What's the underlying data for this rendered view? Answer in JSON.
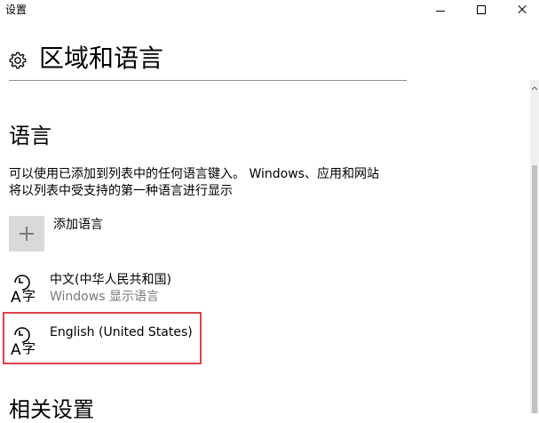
{
  "window": {
    "title": "设置"
  },
  "header": {
    "title": "区域和语言",
    "icon": "gear-icon"
  },
  "language_section": {
    "title": "语言",
    "description_lines": [
      "可以使用已添加到列表中的任何语言键入。 Windows、应用和网站",
      "将以列表中受支持的第一种语言进行显示"
    ],
    "add_language_label": "添加语言",
    "items": [
      {
        "name": "中文(中华人民共和国)",
        "subtitle": "Windows 显示语言"
      },
      {
        "name": "English (United States)",
        "subtitle": ""
      }
    ]
  },
  "related_section": {
    "title": "相关设置"
  },
  "colors": {
    "highlight_border": "#d9434c",
    "divider": "#8f8f8f",
    "secondary_text": "#7a7a7a",
    "tile_bg": "#d9d9d9"
  }
}
